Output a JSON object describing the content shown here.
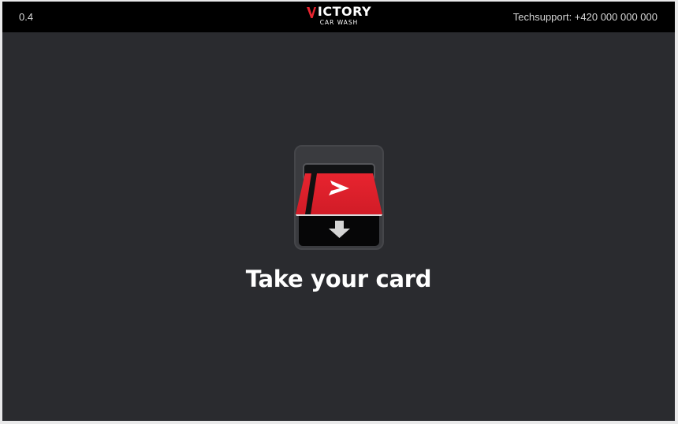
{
  "header": {
    "version": "0.4",
    "brand_name": "ICTORY",
    "brand_sub": "CAR WASH",
    "support": "Techsupport: +420 000 000 000"
  },
  "main": {
    "message": "Take your card"
  },
  "icons": [
    "victory-logo-icon",
    "card-slot-icon",
    "arrow-down-icon"
  ],
  "colors": {
    "background": "#2a2b2f",
    "topbar": "#000000",
    "card_red": "#e8242f",
    "text": "#ffffff"
  }
}
